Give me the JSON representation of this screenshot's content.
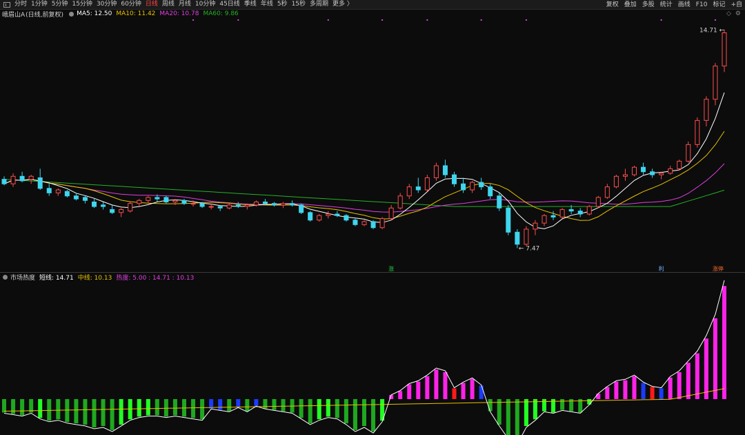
{
  "toolbar": {
    "periods": [
      {
        "label": "分时",
        "active": false
      },
      {
        "label": "1分钟",
        "active": false
      },
      {
        "label": "5分钟",
        "active": false
      },
      {
        "label": "15分钟",
        "active": false
      },
      {
        "label": "30分钟",
        "active": false
      },
      {
        "label": "60分钟",
        "active": false
      },
      {
        "label": "日线",
        "active": true
      },
      {
        "label": "周线",
        "active": false
      },
      {
        "label": "月线",
        "active": false
      },
      {
        "label": "10分钟",
        "active": false
      },
      {
        "label": "45日线",
        "active": false
      },
      {
        "label": "季线",
        "active": false
      },
      {
        "label": "年线",
        "active": false
      },
      {
        "label": "5秒",
        "active": false
      },
      {
        "label": "15秒",
        "active": false
      },
      {
        "label": "多周期",
        "active": false
      },
      {
        "label": "更多 〉",
        "active": false
      }
    ],
    "tools": [
      "复权",
      "叠加",
      "多股",
      "统计",
      "画线",
      "F10",
      "标记",
      "+自"
    ]
  },
  "colors": {
    "up": "#ff4d4d",
    "down": "#3fd5ee",
    "ma5": "#ffffff",
    "ma10": "#e8c200",
    "ma20": "#e040e0",
    "ma60": "#27b027",
    "heat_up": "#ff22e8",
    "heat_down": "#1fa81f",
    "heat_bright": "#22ff22",
    "heat_blue": "#1b3bff",
    "heat_red": "#ff1a1a",
    "mid_line": "#e8c200",
    "ind_line": "#ffffff"
  },
  "main_header": {
    "stock": "峨眉山A",
    "mode": "(日线,前复权)",
    "ma5": "MA5: 12.50",
    "ma10": "MA10: 11.42",
    "ma20": "MA20: 10.78",
    "ma60": "MA60: 9.86"
  },
  "indicator_header": {
    "name": "市场热度",
    "short": "短线: 14.71",
    "mid": "中线: 10.13",
    "heat": "热度: 5.00 : 14.71 : 10.13"
  },
  "chart_data": {
    "type": "candlestick",
    "price_range": [
      7.0,
      15.0
    ],
    "max_label": "14.71",
    "min_label": "7.47",
    "price_max": 14.71,
    "price_min": 7.47,
    "markers": [
      "涨",
      "利",
      "涨停"
    ],
    "ohlc": [
      [
        9.75,
        9.85,
        9.55,
        9.6
      ],
      [
        9.6,
        9.95,
        9.5,
        9.85
      ],
      [
        9.85,
        10.0,
        9.65,
        9.7
      ],
      [
        9.75,
        9.9,
        9.6,
        9.85
      ],
      [
        9.8,
        10.1,
        9.4,
        9.45
      ],
      [
        9.45,
        9.6,
        9.2,
        9.3
      ],
      [
        9.3,
        9.45,
        9.2,
        9.4
      ],
      [
        9.35,
        9.4,
        9.15,
        9.2
      ],
      [
        9.2,
        9.3,
        9.05,
        9.1
      ],
      [
        9.15,
        9.2,
        8.95,
        9.05
      ],
      [
        9.0,
        9.1,
        8.8,
        8.85
      ],
      [
        8.9,
        9.0,
        8.75,
        8.85
      ],
      [
        8.75,
        8.9,
        8.6,
        8.65
      ],
      [
        8.65,
        8.8,
        8.5,
        8.75
      ],
      [
        8.7,
        9.0,
        8.65,
        8.95
      ],
      [
        8.95,
        9.1,
        8.85,
        9.05
      ],
      [
        9.05,
        9.2,
        8.95,
        9.15
      ],
      [
        9.15,
        9.25,
        9.0,
        9.1
      ],
      [
        9.15,
        9.2,
        8.95,
        9.0
      ],
      [
        9.0,
        9.1,
        8.9,
        9.05
      ],
      [
        9.05,
        9.1,
        8.9,
        8.95
      ],
      [
        8.95,
        9.05,
        8.85,
        8.95
      ],
      [
        8.95,
        9.0,
        8.8,
        8.85
      ],
      [
        8.85,
        8.95,
        8.75,
        8.85
      ],
      [
        8.85,
        8.9,
        8.7,
        8.8
      ],
      [
        8.8,
        8.95,
        8.75,
        8.9
      ],
      [
        8.9,
        9.0,
        8.8,
        8.85
      ],
      [
        8.85,
        8.95,
        8.75,
        8.9
      ],
      [
        8.9,
        9.05,
        8.85,
        9.0
      ],
      [
        9.0,
        9.1,
        8.9,
        8.95
      ],
      [
        8.95,
        9.0,
        8.85,
        8.9
      ],
      [
        8.9,
        9.0,
        8.8,
        8.95
      ],
      [
        8.95,
        9.05,
        8.85,
        8.9
      ],
      [
        8.9,
        8.95,
        8.6,
        8.65
      ],
      [
        8.65,
        8.7,
        8.35,
        8.4
      ],
      [
        8.4,
        8.6,
        8.35,
        8.55
      ],
      [
        8.55,
        8.7,
        8.45,
        8.6
      ],
      [
        8.6,
        8.7,
        8.5,
        8.55
      ],
      [
        8.55,
        8.6,
        8.35,
        8.4
      ],
      [
        8.4,
        8.45,
        8.2,
        8.25
      ],
      [
        8.25,
        8.4,
        8.2,
        8.35
      ],
      [
        8.35,
        8.4,
        8.1,
        8.15
      ],
      [
        8.15,
        8.5,
        8.1,
        8.45
      ],
      [
        8.45,
        8.9,
        8.4,
        8.8
      ],
      [
        8.8,
        9.3,
        8.75,
        9.2
      ],
      [
        9.2,
        9.6,
        9.1,
        9.5
      ],
      [
        9.5,
        9.8,
        9.3,
        9.4
      ],
      [
        9.4,
        9.9,
        9.35,
        9.8
      ],
      [
        9.8,
        10.3,
        9.7,
        10.2
      ],
      [
        10.2,
        10.4,
        9.8,
        9.9
      ],
      [
        9.9,
        10.0,
        9.5,
        9.6
      ],
      [
        9.6,
        9.8,
        9.3,
        9.4
      ],
      [
        9.4,
        9.7,
        9.3,
        9.65
      ],
      [
        9.65,
        9.8,
        9.4,
        9.5
      ],
      [
        9.5,
        9.6,
        9.1,
        9.2
      ],
      [
        9.2,
        9.3,
        8.7,
        8.8
      ],
      [
        8.8,
        8.9,
        7.9,
        8.0
      ],
      [
        8.0,
        8.1,
        7.47,
        7.6
      ],
      [
        7.6,
        8.2,
        7.55,
        8.1
      ],
      [
        8.1,
        8.4,
        7.9,
        8.3
      ],
      [
        8.3,
        8.6,
        8.2,
        8.55
      ],
      [
        8.55,
        8.7,
        8.4,
        8.5
      ],
      [
        8.5,
        8.8,
        8.45,
        8.75
      ],
      [
        8.75,
        8.9,
        8.6,
        8.7
      ],
      [
        8.7,
        8.8,
        8.5,
        8.6
      ],
      [
        8.6,
        8.9,
        8.55,
        8.85
      ],
      [
        8.85,
        9.2,
        8.8,
        9.15
      ],
      [
        9.15,
        9.6,
        9.1,
        9.5
      ],
      [
        9.5,
        9.9,
        9.45,
        9.85
      ],
      [
        9.85,
        10.1,
        9.7,
        9.9
      ],
      [
        9.9,
        10.2,
        9.85,
        10.15
      ],
      [
        10.15,
        10.3,
        9.9,
        10.0
      ],
      [
        10.0,
        10.1,
        9.8,
        9.9
      ],
      [
        9.9,
        10.0,
        9.75,
        9.95
      ],
      [
        9.95,
        10.2,
        9.9,
        10.1
      ],
      [
        10.1,
        10.4,
        10.05,
        10.35
      ],
      [
        10.35,
        11.0,
        10.3,
        10.9
      ],
      [
        10.9,
        11.8,
        10.8,
        11.7
      ],
      [
        11.7,
        12.5,
        11.5,
        12.4
      ],
      [
        12.4,
        13.6,
        12.2,
        13.5
      ],
      [
        13.5,
        14.71,
        13.3,
        14.6
      ]
    ],
    "heat": [
      [
        "down",
        -1.0
      ],
      [
        "down",
        -1.1
      ],
      [
        "down",
        -1.2
      ],
      [
        "down",
        -1.0
      ],
      [
        "bright",
        -1.4
      ],
      [
        "down",
        -1.6
      ],
      [
        "down",
        -1.5
      ],
      [
        "down",
        -1.7
      ],
      [
        "down",
        -1.8
      ],
      [
        "down",
        -1.9
      ],
      [
        "down",
        -2.1
      ],
      [
        "down",
        -2.0
      ],
      [
        "down",
        -2.3
      ],
      [
        "bright",
        -1.9
      ],
      [
        "bright",
        -1.5
      ],
      [
        "bright",
        -1.3
      ],
      [
        "bright",
        -1.2
      ],
      [
        "down",
        -1.2
      ],
      [
        "down",
        -1.3
      ],
      [
        "down",
        -1.2
      ],
      [
        "down",
        -1.3
      ],
      [
        "down",
        -1.4
      ],
      [
        "down",
        -1.5
      ],
      [
        "blue",
        -0.7
      ],
      [
        "blue",
        -0.8
      ],
      [
        "down",
        -0.9
      ],
      [
        "blue",
        -0.6
      ],
      [
        "down",
        -0.9
      ],
      [
        "blue",
        -0.5
      ],
      [
        "down",
        -0.7
      ],
      [
        "down",
        -0.8
      ],
      [
        "down",
        -0.9
      ],
      [
        "down",
        -1.0
      ],
      [
        "down",
        -1.4
      ],
      [
        "down",
        -1.8
      ],
      [
        "bright",
        -1.5
      ],
      [
        "bright",
        -1.3
      ],
      [
        "down",
        -1.4
      ],
      [
        "down",
        -1.8
      ],
      [
        "down",
        -2.3
      ],
      [
        "down",
        -2.0
      ],
      [
        "down",
        -2.4
      ],
      [
        "bright",
        -1.6
      ],
      [
        "up",
        0.3
      ],
      [
        "up",
        0.6
      ],
      [
        "up",
        1.1
      ],
      [
        "up",
        1.3
      ],
      [
        "up",
        1.7
      ],
      [
        "up",
        2.2
      ],
      [
        "up",
        2.0
      ],
      [
        "red",
        0.8
      ],
      [
        "up",
        1.2
      ],
      [
        "up",
        1.5
      ],
      [
        "blue",
        1.0
      ],
      [
        "down",
        -0.9
      ],
      [
        "down",
        -1.9
      ],
      [
        "down",
        -2.8
      ],
      [
        "down",
        -3.2
      ],
      [
        "bright",
        -2.0
      ],
      [
        "bright",
        -1.5
      ],
      [
        "bright",
        -0.9
      ],
      [
        "bright",
        -1.0
      ],
      [
        "down",
        -0.8
      ],
      [
        "down",
        -0.9
      ],
      [
        "down",
        -1.0
      ],
      [
        "bright",
        -0.4
      ],
      [
        "up",
        0.4
      ],
      [
        "up",
        0.9
      ],
      [
        "up",
        1.3
      ],
      [
        "up",
        1.4
      ],
      [
        "up",
        1.7
      ],
      [
        "blue",
        1.2
      ],
      [
        "red",
        0.9
      ],
      [
        "blue",
        0.8
      ],
      [
        "up",
        1.6
      ],
      [
        "up",
        2.0
      ],
      [
        "up",
        2.7
      ],
      [
        "up",
        3.4
      ],
      [
        "up",
        4.5
      ],
      [
        "up",
        6.0
      ],
      [
        "up",
        8.4
      ]
    ]
  }
}
